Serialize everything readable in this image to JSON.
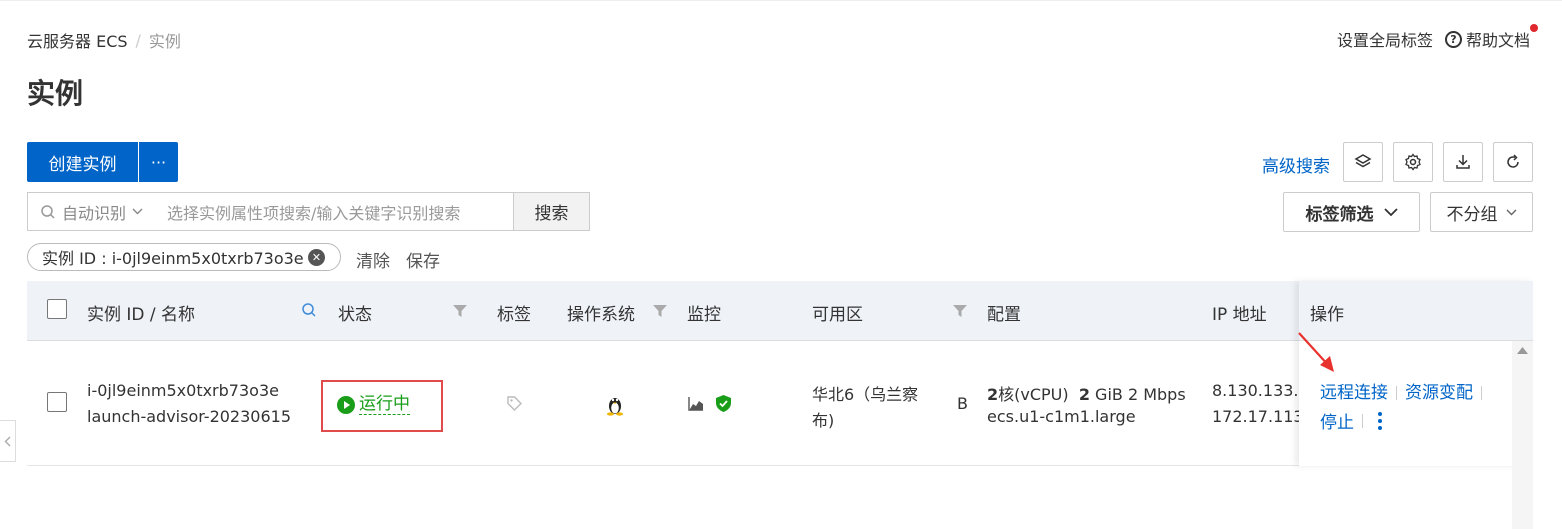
{
  "breadcrumb": {
    "root": "云服务器 ECS",
    "sep": "/",
    "current": "实例"
  },
  "header": {
    "global_tags": "设置全局标签",
    "help_icon": "?",
    "help": "帮助文档"
  },
  "page_title": "实例",
  "toolbar": {
    "create_label": "创建实例",
    "more_label": "···",
    "advanced_search": "高级搜索",
    "icons": [
      "layers-icon",
      "gear-icon",
      "download-icon",
      "refresh-icon"
    ]
  },
  "search": {
    "mode": "自动识别",
    "placeholder": "选择实例属性项搜索/输入关键字识别搜索",
    "button": "搜索"
  },
  "tag_filter": "标签筛选",
  "group_select": "不分组",
  "filter_chip": {
    "label": "实例 ID : i-0jl9einm5x0txrb73o3e"
  },
  "filter_actions": {
    "clear": "清除",
    "save": "保存"
  },
  "table": {
    "columns": {
      "id_name": "实例 ID / 名称",
      "status": "状态",
      "tags": "标签",
      "os": "操作系统",
      "monitor": "监控",
      "zone": "可用区",
      "config": "配置",
      "ip": "IP 地址",
      "ops": "操作"
    },
    "row": {
      "id": "i-0jl9einm5x0txrb73o3e",
      "name": "launch-advisor-20230615",
      "status": "运行中",
      "zone_line1": "华北6（乌兰察",
      "zone_line2": "布)",
      "zone_suffix": "B",
      "config_cores": "2",
      "config_cores_unit": "核(vCPU)",
      "config_mem": "2",
      "config_mem_unit": "GiB 2 Mbps",
      "config_type": "ecs.u1-c1m1.large",
      "ip_public": "8.130.133.1",
      "ip_private": "172.17.113.",
      "ops": {
        "remote": "远程连接",
        "resize": "资源变配",
        "stop": "停止"
      }
    }
  },
  "colors": {
    "primary": "#0064c8",
    "running": "#1a9e1a",
    "highlight": "#e04b4b",
    "arrow": "#e8322e"
  }
}
